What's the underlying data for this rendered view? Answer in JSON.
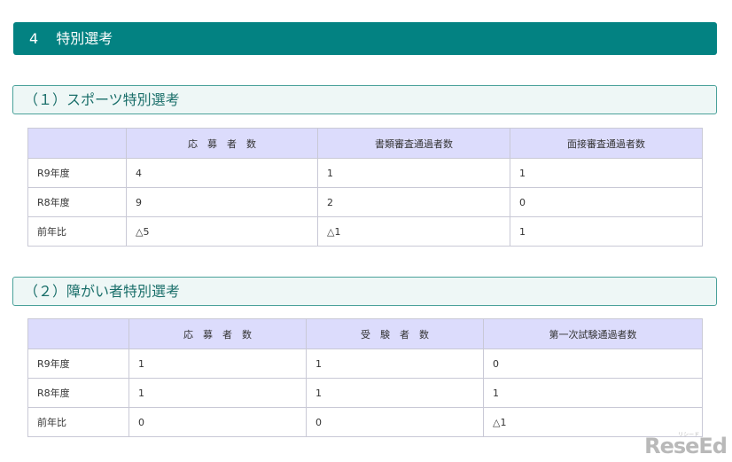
{
  "header": {
    "number": "4",
    "title": "特別選考"
  },
  "sections": [
    {
      "title": "（１）スポーツ特別選考",
      "columns": [
        "",
        "応　募　者　数",
        "書類審査通過者数",
        "面接審査通過者数"
      ],
      "rows": [
        [
          "R9年度",
          "4",
          "1",
          "1"
        ],
        [
          "R8年度",
          "9",
          "2",
          "0"
        ],
        [
          "前年比",
          "△5",
          "△1",
          "1"
        ]
      ]
    },
    {
      "title": "（２）障がい者特別選考",
      "columns": [
        "",
        "応　募　者　数",
        "受　験　者　数",
        "第一次試験通過者数"
      ],
      "rows": [
        [
          "R9年度",
          "1",
          "1",
          "0"
        ],
        [
          "R8年度",
          "1",
          "1",
          "1"
        ],
        [
          "前年比",
          "0",
          "0",
          "△1"
        ]
      ]
    }
  ],
  "logo": {
    "text": "ReseEd",
    "ruby": "リシード"
  },
  "colors": {
    "header_bg": "#038282",
    "table_header_bg": "#dcdcfc",
    "subheader_border": "#4aa19a"
  }
}
